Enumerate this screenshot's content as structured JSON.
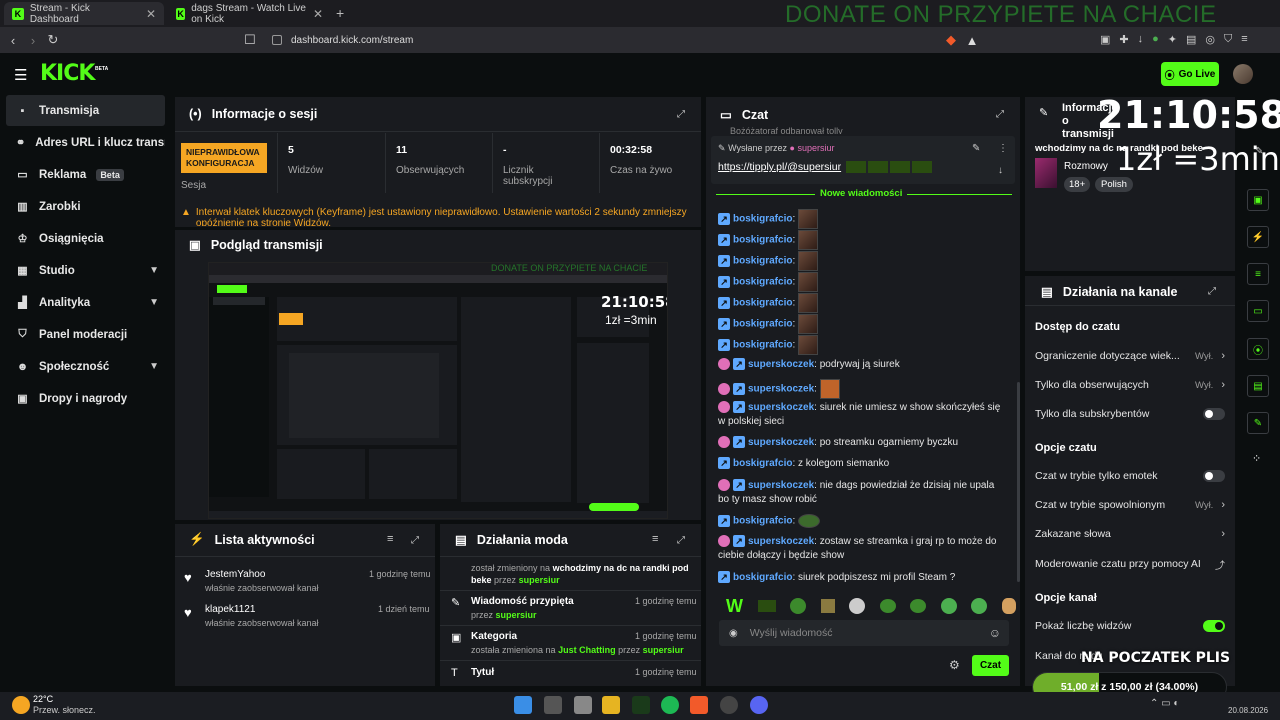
{
  "browser": {
    "tabs": [
      {
        "title": "Stream - Kick Dashboard"
      },
      {
        "title": "dags Stream - Watch Live on Kick"
      }
    ],
    "url": "dashboard.kick.com/stream"
  },
  "overlay": {
    "donate": "DONATE ON PRZYPIETE NA CHACIE",
    "time": "21:10:58",
    "rate": "1zł =3min",
    "goal_title": "NA POCZATEK PLIS",
    "goal_progress": "51,00 zł z 150,00 zł (34.00%)",
    "goal_fraction": 0.34
  },
  "app": {
    "logo": "KICK",
    "logo_beta": "BETA",
    "go_live": "Go Live"
  },
  "sidebar": {
    "items": [
      {
        "label": "Transmisja",
        "icon": "broadcast-icon"
      },
      {
        "label": "Adres URL i klucz transmisji",
        "icon": "link-icon"
      },
      {
        "label": "Reklama",
        "icon": "ad-icon",
        "badge": "Beta"
      },
      {
        "label": "Zarobki",
        "icon": "chart-icon"
      },
      {
        "label": "Osiągnięcia",
        "icon": "trophy-icon"
      },
      {
        "label": "Studio",
        "icon": "grid-icon"
      },
      {
        "label": "Analityka",
        "icon": "analytics-icon"
      },
      {
        "label": "Panel moderacji",
        "icon": "shield-icon"
      },
      {
        "label": "Społeczność",
        "icon": "community-icon"
      },
      {
        "label": "Dropy i nagrody",
        "icon": "gift-icon"
      }
    ]
  },
  "session": {
    "title": "Informacje o sesji",
    "badge": "NIEPRAWIDŁOWA KONFIGURACJA",
    "badge_label": "Sesja",
    "stats": [
      {
        "value": "5",
        "label": "Widzów"
      },
      {
        "value": "11",
        "label": "Obserwujących"
      },
      {
        "value": "-",
        "label": "Licznik subskrypcji"
      },
      {
        "value": "00:32:58",
        "label": "Czas na żywo"
      }
    ],
    "warning": "Interwał klatek kluczowych (Keyframe) jest ustawiony nieprawidłowo. Ustawienie wartości 2 sekundy zmniejszy opóźnienie na stronie Widzów."
  },
  "preview": {
    "title": "Podgląd transmisji"
  },
  "activity": {
    "title": "Lista aktywności",
    "items": [
      {
        "name": "JestemYahoo",
        "desc": "właśnie zaobserwował kanał",
        "time": "1 godzinę temu"
      },
      {
        "name": "klapek1121",
        "desc": "właśnie zaobserwował kanał",
        "time": "1 dzień temu"
      }
    ]
  },
  "modactions": {
    "title": "Działania moda",
    "top_partial": {
      "pre": "został zmieniony na",
      "title": "wchodzimy na dc na randki pod beke",
      "by": "przez",
      "user": "supersiur"
    },
    "items": [
      {
        "label": "Wiadomość przypięta",
        "pre": "przez",
        "user": "supersiur",
        "extra": "",
        "time": "1 godzinę temu"
      },
      {
        "label": "Kategoria",
        "pre": "została zmieniona na",
        "extra": "Just Chatting",
        "by": "przez",
        "user": "supersiur",
        "time": "1 godzinę temu"
      },
      {
        "label": "Tytuł",
        "pre": "",
        "extra": "",
        "user": "",
        "time": "1 godzinę temu"
      }
    ]
  },
  "chat": {
    "title": "Czat",
    "partial_top": "Bożóżatoraf odbanował tolly",
    "pinned_by_label": "Wysłane przez",
    "pinned_by_user": "supersiur",
    "pinned_link": "https://tipply.pl/@supersiur",
    "new_messages": "Nowe wiadomości",
    "messages": [
      {
        "user": "boskigrafcio",
        "text": ":",
        "emote": true,
        "sub": false
      },
      {
        "user": "boskigrafcio",
        "text": ":",
        "emote": true,
        "sub": false
      },
      {
        "user": "boskigrafcio",
        "text": ":",
        "emote": true,
        "sub": false
      },
      {
        "user": "boskigrafcio",
        "text": ":",
        "emote": true,
        "sub": false
      },
      {
        "user": "boskigrafcio",
        "text": ":",
        "emote": true,
        "sub": false
      },
      {
        "user": "boskigrafcio",
        "text": ":",
        "emote": true,
        "sub": false
      },
      {
        "user": "boskigrafcio",
        "text": ":",
        "emote": true,
        "sub": false
      },
      {
        "user": "superskoczek",
        "text": ": podrywaj ją siurek",
        "emote": false,
        "sub": true
      },
      {
        "user": "superskoczek",
        "text": ":",
        "emote": true,
        "sub": true
      },
      {
        "user": "superskoczek",
        "text": ": siurek nie umiesz w show skończyłeś się w polskiej sieci",
        "emote": false,
        "sub": true
      },
      {
        "user": "superskoczek",
        "text": ": po streamku ogarniemy byczku",
        "emote": false,
        "sub": true
      },
      {
        "user": "boskigrafcio",
        "text": ": z kolegom siemanko",
        "emote": false,
        "sub": false
      },
      {
        "user": "superskoczek",
        "text": ": nie dags powiedział że dzisiaj nie upala bo ty masz show robić",
        "emote": false,
        "sub": true
      },
      {
        "user": "boskigrafcio",
        "text": ":",
        "emote": true,
        "sub": false
      },
      {
        "user": "superskoczek",
        "text": ": zostaw se streamka i graj rp to może do ciebie dołączy i będzie show",
        "emote": false,
        "sub": true
      },
      {
        "user": "boskigrafcio",
        "text": ": siurek podpiszesz mi profil Steam ?",
        "emote": false,
        "sub": false
      }
    ],
    "input_placeholder": "Wyślij wiadomość",
    "send_label": "Czat"
  },
  "channel": {
    "info_title": "Informacje o transmisji",
    "stream_title": "wchodzimy na dc na randki pod beke",
    "category": "Rozmowy",
    "tags": [
      "18+",
      "Polish"
    ],
    "actions_title": "Działania na kanale",
    "sections": [
      {
        "title": "Dostęp do czatu",
        "rows": [
          {
            "label": "Ograniczenie dotyczące wiek...",
            "value": "Wył.",
            "type": "arrow"
          },
          {
            "label": "Tylko dla obserwujących",
            "value": "Wył.",
            "type": "arrow"
          },
          {
            "label": "Tylko dla subskrybentów",
            "value": "",
            "type": "toggle",
            "on": false
          }
        ]
      },
      {
        "title": "Opcje czatu",
        "rows": [
          {
            "label": "Czat w trybie tylko emotek",
            "value": "",
            "type": "toggle",
            "on": false
          },
          {
            "label": "Czat w trybie spowolnionym",
            "value": "Wył.",
            "type": "arrow"
          },
          {
            "label": "Zakazane słowa",
            "value": "",
            "type": "arrow"
          },
          {
            "label": "Moderowanie czatu przy pomocy AI",
            "value": "",
            "type": "ext"
          }
        ]
      },
      {
        "title": "Opcje kanał",
        "rows": [
          {
            "label": "Pokaż liczbę widzów",
            "value": "",
            "type": "toggle",
            "on": true
          },
          {
            "label": "Kanał do raidu",
            "value": "",
            "type": "none"
          }
        ]
      }
    ]
  },
  "taskbar": {
    "weather_temp": "22°C",
    "weather_desc": "Przew. słonecz.",
    "date": "20.08.2026"
  },
  "colors": {
    "accent": "#53fc18",
    "warning": "#f5a623",
    "username": "#5fa9ff",
    "panel": "#191b1f"
  }
}
